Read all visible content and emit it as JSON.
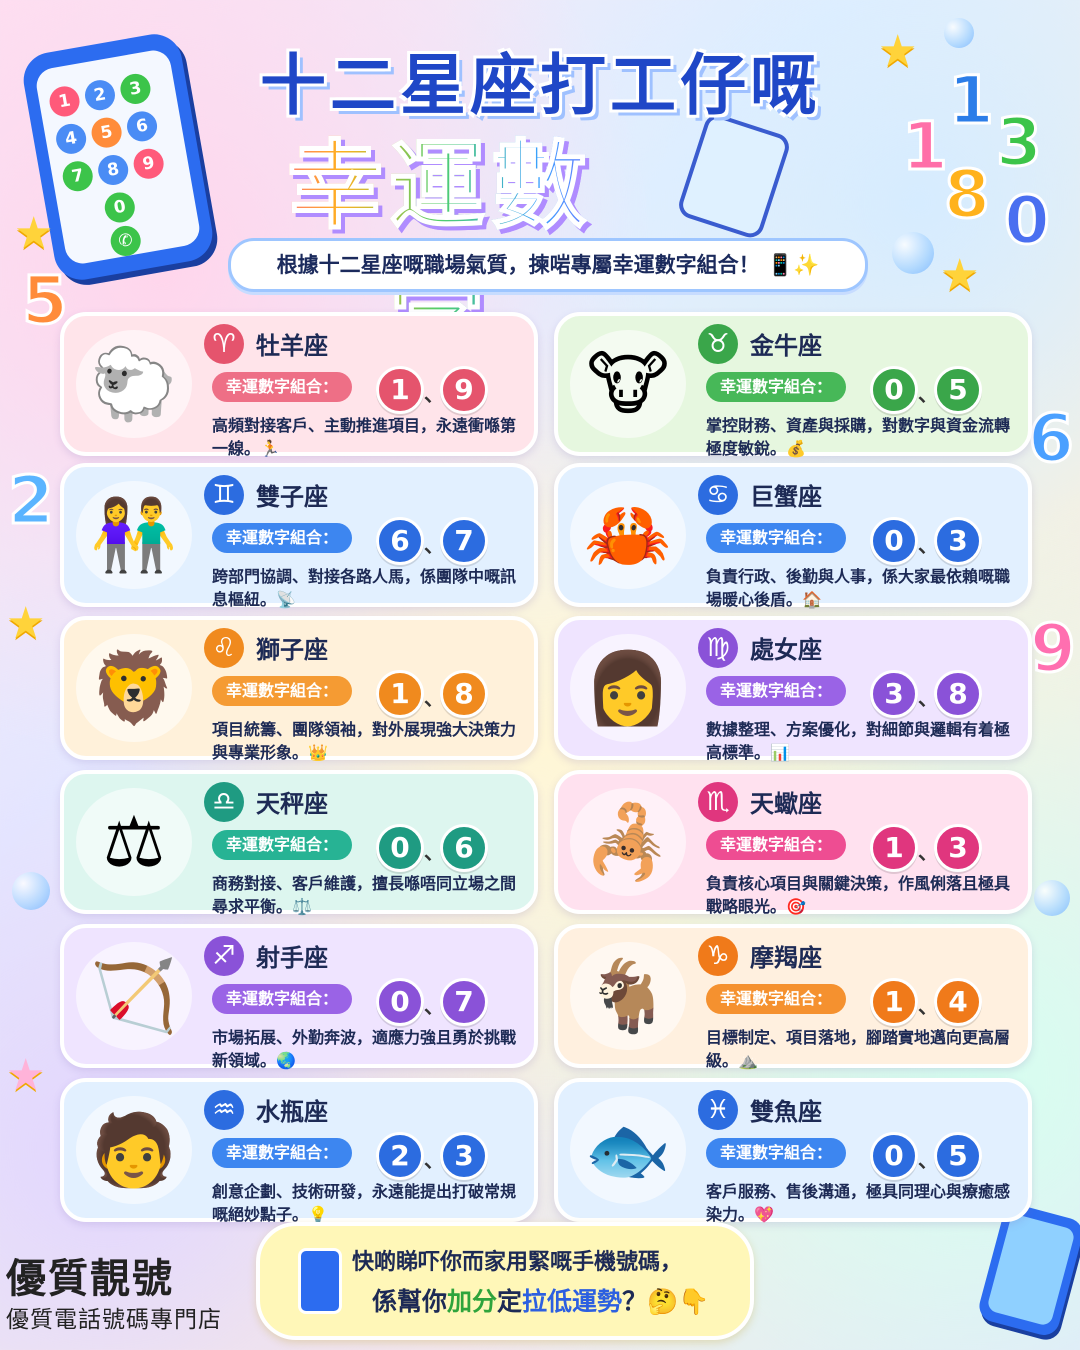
{
  "header": {
    "title_line1": "十二星座打工仔嘅",
    "title_line2": "幸運數字",
    "subtitle": "根據十二星座嘅職場氣質，揀啱專屬幸運數字組合！"
  },
  "pill_label": "幸運數字組合：",
  "signs": [
    {
      "name": "牡羊座",
      "symbol": "♈",
      "avatar": "🐑",
      "numbers": [
        "1",
        "9"
      ],
      "desc": "高頻對接客戶、主動推進項目，永遠衝喺第一線。🏃"
    },
    {
      "name": "金牛座",
      "symbol": "♉",
      "avatar": "🐮",
      "numbers": [
        "0",
        "5"
      ],
      "desc": "掌控財務、資產與採購，對數字與資金流轉極度敏銳。💰"
    },
    {
      "name": "雙子座",
      "symbol": "♊",
      "avatar": "👫",
      "numbers": [
        "6",
        "7"
      ],
      "desc": "跨部門協調、對接各路人馬，係團隊中嘅訊息樞紐。📡"
    },
    {
      "name": "巨蟹座",
      "symbol": "♋",
      "avatar": "🦀",
      "numbers": [
        "0",
        "3"
      ],
      "desc": "負責行政、後勤與人事，係大家最依賴嘅職場暖心後盾。🏠"
    },
    {
      "name": "獅子座",
      "symbol": "♌",
      "avatar": "🦁",
      "numbers": [
        "1",
        "8"
      ],
      "desc": "項目統籌、團隊領袖，對外展現強大決策力與專業形象。👑"
    },
    {
      "name": "處女座",
      "symbol": "♍",
      "avatar": "👩",
      "numbers": [
        "3",
        "8"
      ],
      "desc": "數據整理、方案優化，對細節與邏輯有着極高標準。📊"
    },
    {
      "name": "天秤座",
      "symbol": "♎",
      "avatar": "⚖",
      "numbers": [
        "0",
        "6"
      ],
      "desc": "商務對接、客戶維護，擅長喺唔同立場之間尋求平衡。⚖️"
    },
    {
      "name": "天蠍座",
      "symbol": "♏",
      "avatar": "🦂",
      "numbers": [
        "1",
        "3"
      ],
      "desc": "負責核心項目與關鍵決策，作風俐落且極具戰略眼光。🎯"
    },
    {
      "name": "射手座",
      "symbol": "♐",
      "avatar": "🏹",
      "numbers": [
        "0",
        "7"
      ],
      "desc": "市場拓展、外勤奔波，適應力強且勇於挑戰新領域。🌏"
    },
    {
      "name": "摩羯座",
      "symbol": "♑",
      "avatar": "🐐",
      "numbers": [
        "1",
        "4"
      ],
      "desc": "目標制定、項目落地，腳踏實地邁向更高層級。⛰️"
    },
    {
      "name": "水瓶座",
      "symbol": "♒",
      "avatar": "🧑",
      "numbers": [
        "2",
        "3"
      ],
      "desc": "創意企劃、技術研發，永遠能提出打破常規嘅絕妙點子。💡"
    },
    {
      "name": "雙魚座",
      "symbol": "♓",
      "avatar": "🐟",
      "numbers": [
        "0",
        "5"
      ],
      "desc": "客戶服務、售後溝通，極具同理心與療癒感染力。💖"
    }
  ],
  "footer": {
    "line1": "快啲睇吓你而家用緊嘅手機號碼，",
    "line2_a": "係幫你",
    "line2_b": "加分",
    "line2_c": "定",
    "line2_d": "拉低運勢",
    "line2_e": "？🤔👇"
  },
  "brand": {
    "name": "優質靚號",
    "tagline": "優質電話號碼專門店"
  },
  "phone_keys": [
    "1",
    "2",
    "3",
    "4",
    "5",
    "6",
    "7",
    "8",
    "9",
    "0"
  ],
  "float_numbers": [
    "5",
    "2",
    "6",
    "9",
    "1",
    "1",
    "3",
    "8",
    "0"
  ],
  "colors": {
    "card_themes": [
      [
        "#ffe4ea",
        "#e5546d",
        "#ee6f86"
      ],
      [
        "#e6f7df",
        "#3aa64a",
        "#47b858"
      ],
      [
        "#e2f0ff",
        "#2c6ce0",
        "#3d86f0"
      ],
      [
        "#e2f0ff",
        "#2c6ce0",
        "#3d86f0"
      ],
      [
        "#fff1da",
        "#f08a1e",
        "#f59b33"
      ],
      [
        "#efe4ff",
        "#8a52d8",
        "#9a63e6"
      ],
      [
        "#ddf6ef",
        "#1f9b82",
        "#27b394"
      ],
      [
        "#ffe1ef",
        "#e0367e",
        "#ee4d92"
      ],
      [
        "#efe4ff",
        "#8a52d8",
        "#9a63e6"
      ],
      [
        "#fff0df",
        "#f07a1a",
        "#f5912f"
      ],
      [
        "#e2f0ff",
        "#2c6ce0",
        "#3d86f0"
      ],
      [
        "#e2f0ff",
        "#2c6ce0",
        "#3d86f0"
      ]
    ]
  }
}
